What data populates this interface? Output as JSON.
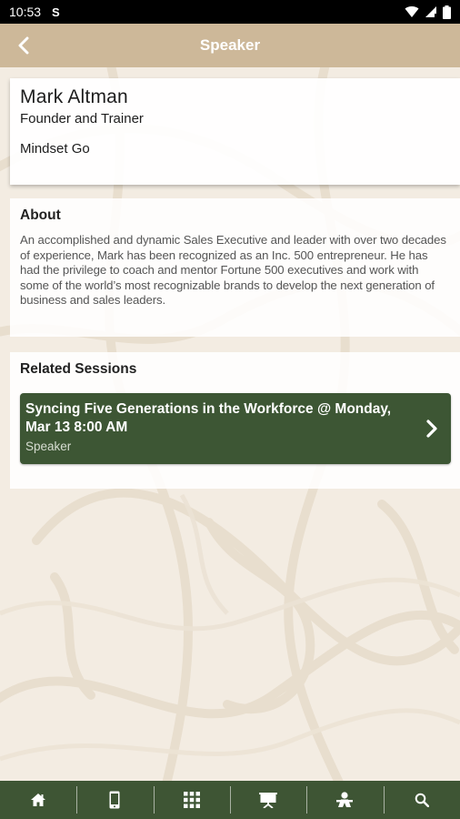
{
  "status_bar": {
    "time": "10:53",
    "app_icon": "S"
  },
  "app_bar": {
    "title": "Speaker",
    "back_icon": "chevron-left-icon"
  },
  "speaker": {
    "name": "Mark Altman",
    "title": "Founder and Trainer",
    "company": "Mindset Go"
  },
  "about": {
    "heading": "About",
    "text": "An accomplished and dynamic Sales Executive and leader with over two decades of experience, Mark has been recognized as an Inc. 500 entrepreneur. He has had the privilege to coach and mentor Fortune 500 executives and work with some of the world’s most recognizable brands to develop the next generation of business and sales leaders."
  },
  "related_sessions": {
    "heading": "Related Sessions",
    "items": [
      {
        "title": "Syncing Five Generations in the Workforce @ Monday, Mar 13 8:00 AM",
        "role": "Speaker"
      }
    ]
  },
  "tab_bar": {
    "tabs": [
      {
        "icon": "home-icon"
      },
      {
        "icon": "phone-icon"
      },
      {
        "icon": "grid-icon"
      },
      {
        "icon": "presentation-icon"
      },
      {
        "icon": "person-icon"
      },
      {
        "icon": "search-icon"
      }
    ]
  },
  "colors": {
    "app_bar": "#cdb899",
    "background": "#f3ece2",
    "accent_green": "#3e5534"
  }
}
